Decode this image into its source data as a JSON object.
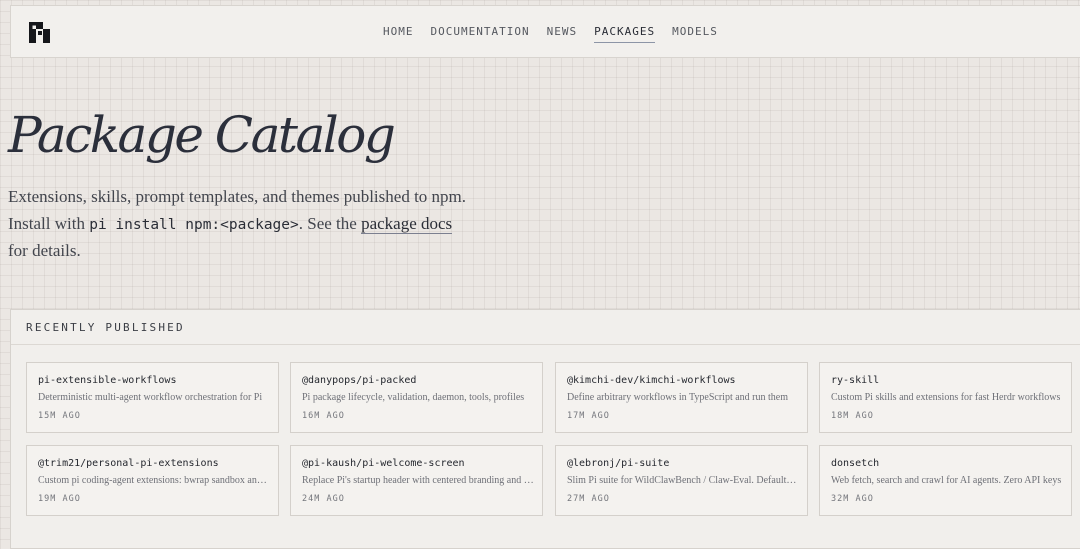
{
  "nav": {
    "items": [
      {
        "label": "HOME",
        "active": false
      },
      {
        "label": "DOCUMENTATION",
        "active": false
      },
      {
        "label": "NEWS",
        "active": false
      },
      {
        "label": "PACKAGES",
        "active": true
      },
      {
        "label": "MODELS",
        "active": false
      }
    ]
  },
  "hero": {
    "title": "Package Catalog",
    "line1": "Extensions, skills, prompt templates, and themes published to npm.",
    "install_prefix": "Install with ",
    "install_code": "pi install npm:<package>",
    "see_text": ". See the ",
    "docs_link": "package docs",
    "line3": "for details."
  },
  "recent": {
    "title": "RECENTLY PUBLISHED",
    "packages": [
      {
        "name": "pi-extensible-workflows",
        "description": "Deterministic multi-agent workflow orchestration for Pi",
        "time": "15M AGO"
      },
      {
        "name": "@danypops/pi-packed",
        "description": "Pi package lifecycle, validation, daemon, tools, profiles",
        "time": "16M AGO"
      },
      {
        "name": "@kimchi-dev/kimchi-workflows",
        "description": "Define arbitrary workflows in TypeScript and run them",
        "time": "17M AGO"
      },
      {
        "name": "ry-skill",
        "description": "Custom Pi skills and extensions for fast Herdr workflows",
        "time": "18M AGO"
      },
      {
        "name": "@trim21/personal-pi-extensions",
        "description": "Custom pi coding-agent extensions: bwrap sandbox and more",
        "time": "19M AGO"
      },
      {
        "name": "@pi-kaush/pi-welcome-screen",
        "description": "Replace Pi's startup header with centered branding and tips",
        "time": "24M AGO"
      },
      {
        "name": "@lebronj/pi-suite",
        "description": "Slim Pi suite for WildClawBench / Claw-Eval. Defaults tuned",
        "time": "27M AGO"
      },
      {
        "name": "donsetch",
        "description": "Web fetch, search and crawl for AI agents. Zero API keys",
        "time": "32M AGO"
      }
    ]
  }
}
